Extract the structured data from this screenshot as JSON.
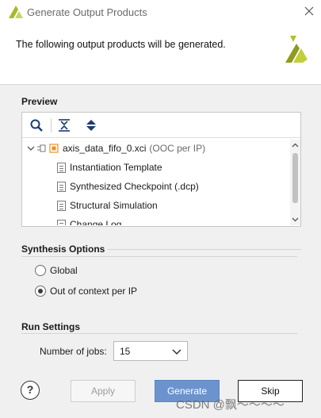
{
  "window": {
    "title": "Generate Output Products",
    "close_icon": "close-icon",
    "logo_icon": "xilinx-logo-icon"
  },
  "header": {
    "message": "The following output products will be generated."
  },
  "preview": {
    "label": "Preview",
    "toolbar_icons": [
      "search-icon",
      "collapse-all-icon",
      "expand-all-icon"
    ],
    "tree": {
      "root": {
        "name": "axis_data_fifo_0.xci",
        "suffix": "(OOC per IP)"
      },
      "children": [
        "Instantiation Template",
        "Synthesized Checkpoint (.dcp)",
        "Structural Simulation",
        "Change Log"
      ]
    }
  },
  "synthesis": {
    "label": "Synthesis Options",
    "options": [
      "Global",
      "Out of context per IP"
    ],
    "selected": "Out of context per IP"
  },
  "run": {
    "label": "Run Settings",
    "jobs_label": "Number of jobs:",
    "jobs_value": "15"
  },
  "buttons": {
    "help": "?",
    "apply": "Apply",
    "generate": "Generate",
    "skip": "Skip"
  },
  "watermark": "CSDN @飘～～～～",
  "colors": {
    "primary_button": "#6b94cf",
    "ip_icon": "#e8902a",
    "logo": "#a8b828"
  }
}
